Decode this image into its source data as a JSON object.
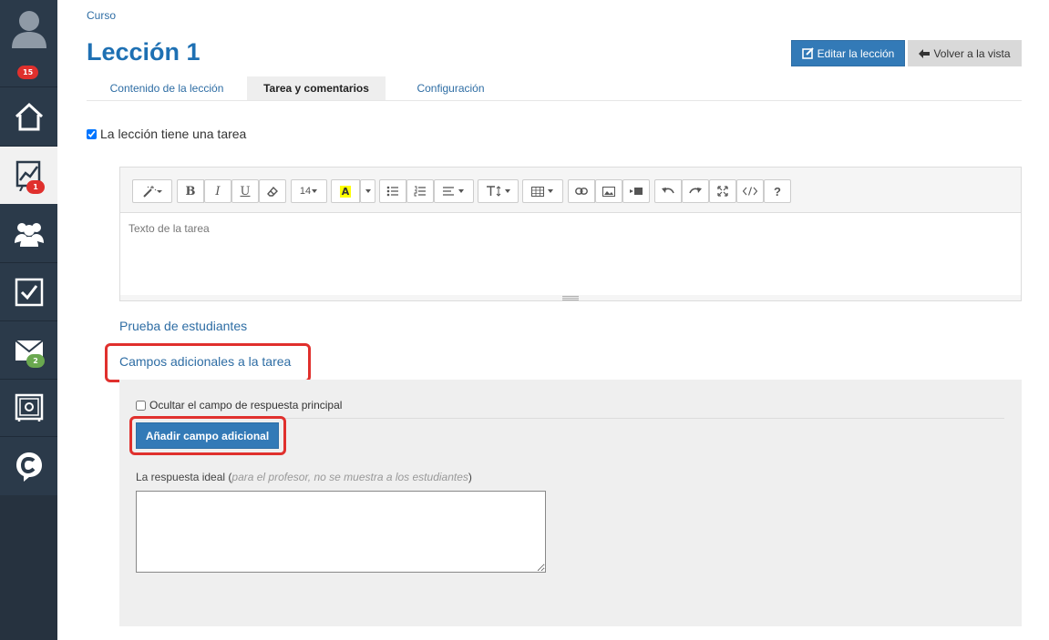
{
  "sidebar": {
    "profile_badge": "15",
    "courses_badge": "1",
    "messages_badge": "2"
  },
  "breadcrumb": "Curso",
  "title": "Lección 1",
  "buttons": {
    "edit": "Editar la lección",
    "back": "Volver a la vista"
  },
  "tabs": [
    {
      "label": "Contenido de la lección",
      "active": false
    },
    {
      "label": "Tarea y comentarios",
      "active": true
    },
    {
      "label": "Configuración",
      "active": false
    }
  ],
  "task_checkbox_label": "La lección tiene una tarea",
  "editor": {
    "placeholder": "Texto de la tarea",
    "font_size": "14",
    "highlight_glyph": "A",
    "help_glyph": "?"
  },
  "links": {
    "students_test": "Prueba de estudiantes",
    "extra_fields": "Campos adicionales a la tarea"
  },
  "panel": {
    "hide_checkbox_label": "Ocultar el campo de respuesta principal",
    "add_button": "Añadir campo adicional",
    "ideal_label": "La respuesta ideal (",
    "ideal_note": "para el profesor, no se muestra a los estudiantes",
    "ideal_label_end": ")"
  },
  "colors": {
    "sidebar": "#2b3a4a",
    "primary": "#337ab7",
    "title": "#1e70b3",
    "highlight_outline": "#e0302d"
  }
}
